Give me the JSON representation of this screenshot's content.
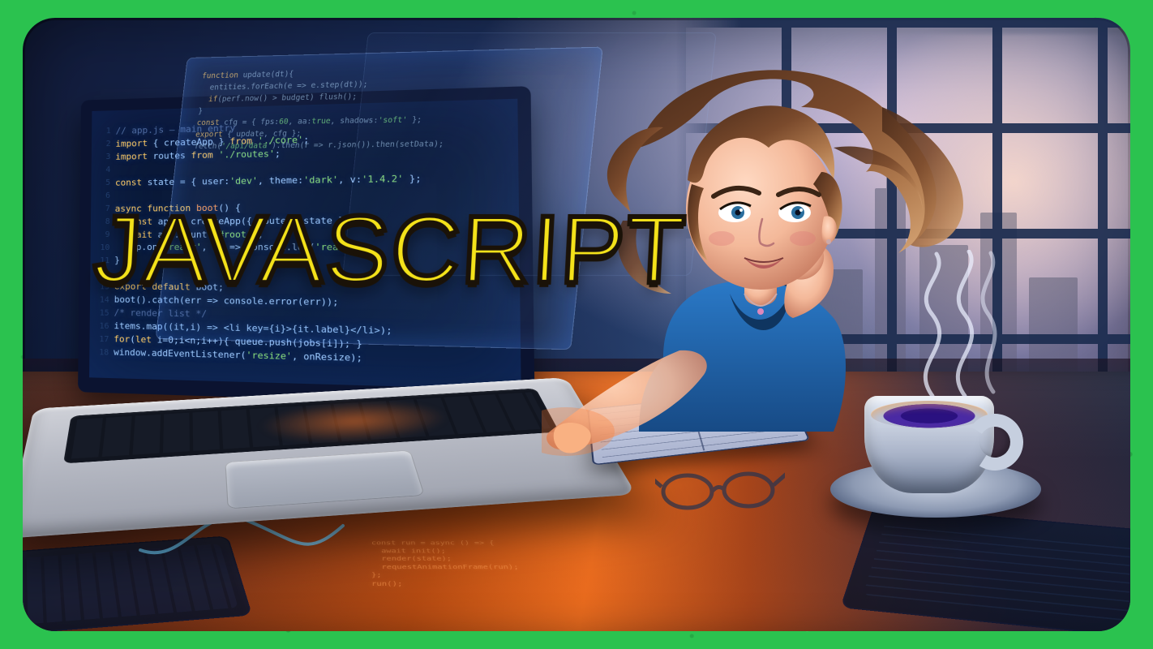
{
  "title_text": "JAVASCRIPT",
  "colors": {
    "frame_green": "#2bc24f",
    "title_yellow": "#f4e21a",
    "title_outline": "#1a1208"
  },
  "scene": {
    "subject": "female-developer-at-laptop",
    "props": [
      "laptop",
      "holographic-code-panels",
      "coffee-cup-with-steam",
      "notebook-and-pen",
      "eyeglasses",
      "window-with-city-skyline",
      "keyboard",
      "tablet"
    ]
  }
}
